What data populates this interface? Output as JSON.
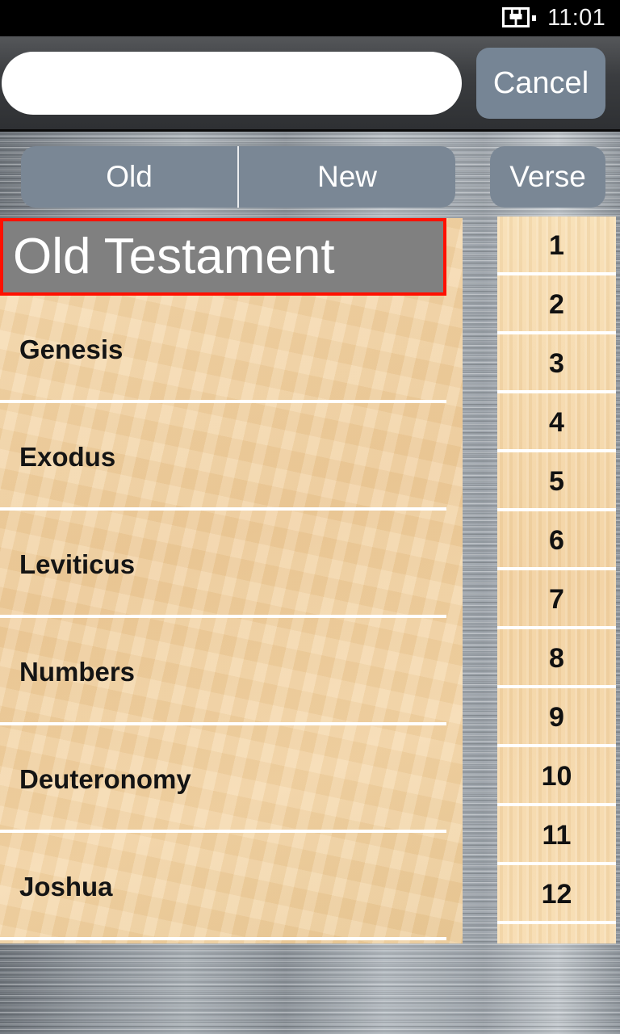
{
  "status_bar": {
    "battery_icon": "battery-charging-icon",
    "time": "11:01"
  },
  "search": {
    "value": "",
    "placeholder": "",
    "cancel_label": "Cancel"
  },
  "tabs": {
    "segmented": [
      {
        "label": "Old",
        "selected": true
      },
      {
        "label": "New",
        "selected": false
      }
    ],
    "verse_label": "Verse"
  },
  "book_list": {
    "header": "Old Testament",
    "header_highlight_color": "#ff1000",
    "header_bg_color": "#808080",
    "items": [
      {
        "label": "Genesis"
      },
      {
        "label": "Exodus"
      },
      {
        "label": "Leviticus"
      },
      {
        "label": "Numbers"
      },
      {
        "label": "Deuteronomy"
      },
      {
        "label": "Joshua"
      }
    ]
  },
  "chapter_list": {
    "items": [
      {
        "label": "1"
      },
      {
        "label": "2"
      },
      {
        "label": "3"
      },
      {
        "label": "4"
      },
      {
        "label": "5"
      },
      {
        "label": "6"
      },
      {
        "label": "7"
      },
      {
        "label": "8"
      },
      {
        "label": "9"
      },
      {
        "label": "10"
      },
      {
        "label": "11"
      },
      {
        "label": "12"
      }
    ]
  },
  "colors": {
    "accent_slate": "#7a8795",
    "parchment": "#f3d3a3",
    "status_bar_bg": "#000000",
    "search_bar_bg": "#3b3d40"
  }
}
